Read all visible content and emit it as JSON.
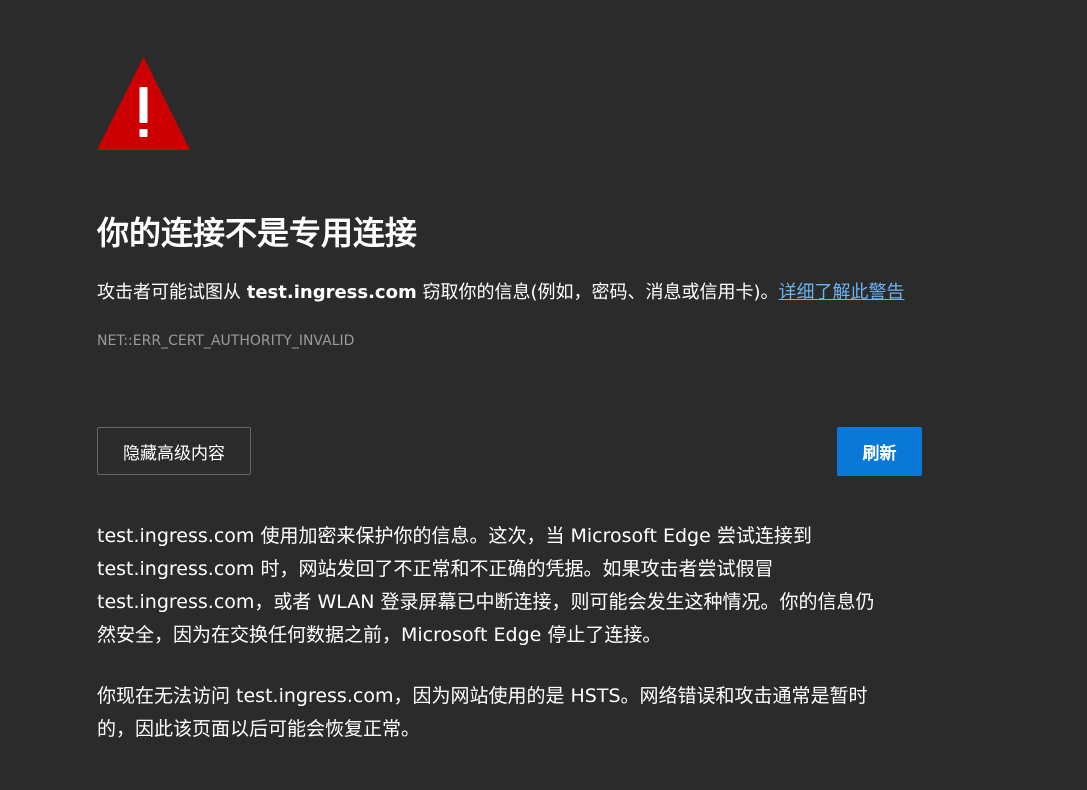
{
  "icon": {
    "name": "warning-triangle-icon",
    "color": "#cc0000"
  },
  "title": "你的连接不是专用连接",
  "description": {
    "prefix": "攻击者可能试图从 ",
    "host": "test.ingress.com",
    "suffix": " 窃取你的信息(例如，密码、消息或信用卡)。",
    "link_label": "详细了解此警告"
  },
  "error_code": "NET::ERR_CERT_AUTHORITY_INVALID",
  "buttons": {
    "advanced_label": "隐藏高级内容",
    "refresh_label": "刷新"
  },
  "colors": {
    "background": "#2b2b2b",
    "link": "#6db2f2",
    "primary_button": "#0a78d7"
  },
  "details": {
    "paragraph1_lines": [
      "test.ingress.com 使用加密来保护你的信息。这次，当 Microsoft Edge 尝试连接到",
      "test.ingress.com 时，网站发回了不正常和不正确的凭据。如果攻击者尝试假冒",
      "test.ingress.com，或者 WLAN 登录屏幕已中断连接，则可能会发生这种情况。你的信息仍",
      "然安全，因为在交换任何数据之前，Microsoft Edge 停止了连接。"
    ],
    "paragraph2_lines": [
      "你现在无法访问 test.ingress.com，因为网站使用的是 HSTS。网络错误和攻击通常是暂时",
      "的，因此该页面以后可能会恢复正常。"
    ]
  }
}
